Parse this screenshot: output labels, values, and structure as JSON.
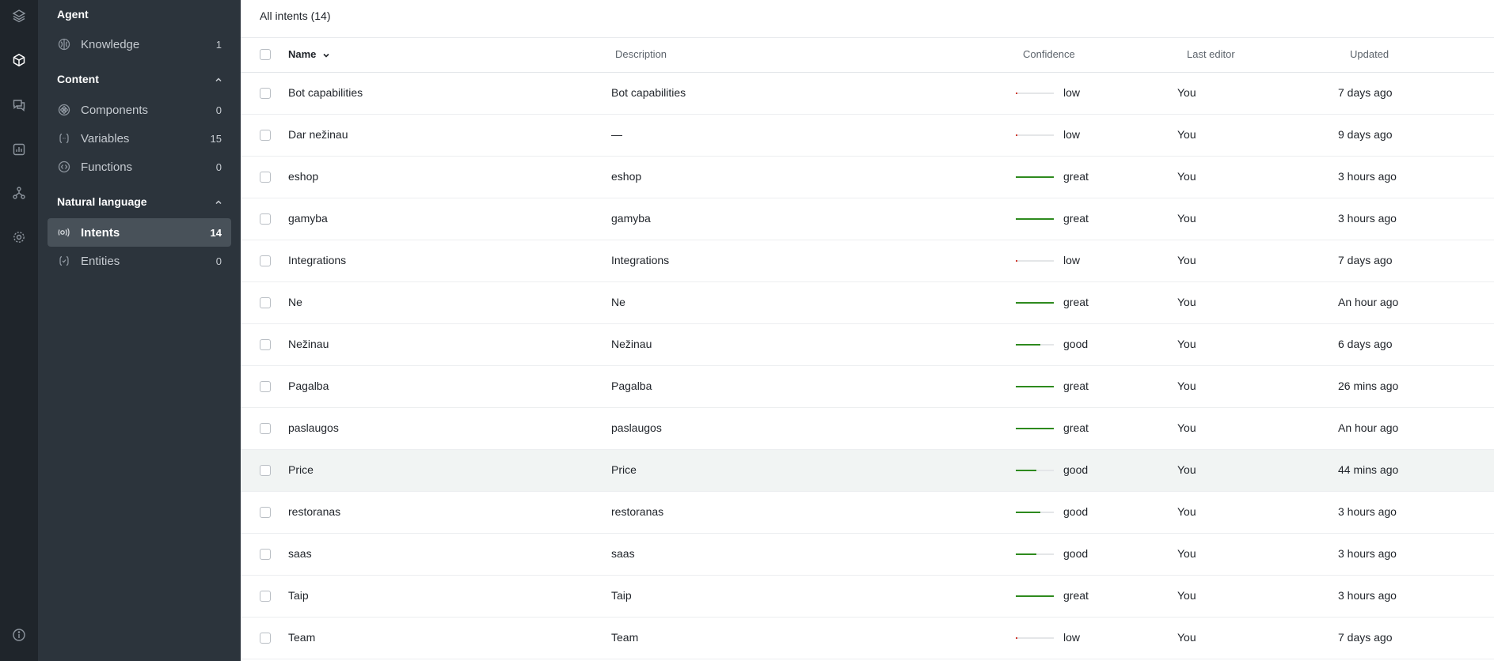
{
  "sidebar": {
    "sections": [
      {
        "title": "Agent",
        "collapsible": false,
        "items": [
          {
            "label": "Knowledge",
            "count": "1",
            "icon": "brain-icon"
          }
        ]
      },
      {
        "title": "Content",
        "collapsible": true,
        "items": [
          {
            "label": "Components",
            "count": "0",
            "icon": "components-icon"
          },
          {
            "label": "Variables",
            "count": "15",
            "icon": "variables-icon"
          },
          {
            "label": "Functions",
            "count": "0",
            "icon": "functions-icon"
          }
        ]
      },
      {
        "title": "Natural language",
        "collapsible": true,
        "items": [
          {
            "label": "Intents",
            "count": "14",
            "icon": "intents-icon",
            "active": true
          },
          {
            "label": "Entities",
            "count": "0",
            "icon": "entities-icon"
          }
        ]
      }
    ]
  },
  "main": {
    "title": "All intents (14)",
    "columns": {
      "name": "Name",
      "description": "Description",
      "confidence": "Confidence",
      "last_editor": "Last editor",
      "updated": "Updated"
    },
    "rows": [
      {
        "name": "Bot capabilities",
        "description": "Bot capabilities",
        "confidence": "low",
        "level": 0.04,
        "editor": "You",
        "updated": "7 days ago"
      },
      {
        "name": "Dar nežinau",
        "description": "—",
        "confidence": "low",
        "level": 0.04,
        "editor": "You",
        "updated": "9 days ago"
      },
      {
        "name": "eshop",
        "description": "eshop",
        "confidence": "great",
        "level": 1.0,
        "editor": "You",
        "updated": "3 hours ago"
      },
      {
        "name": "gamyba",
        "description": "gamyba",
        "confidence": "great",
        "level": 1.0,
        "editor": "You",
        "updated": "3 hours ago"
      },
      {
        "name": "Integrations",
        "description": "Integrations",
        "confidence": "low",
        "level": 0.04,
        "editor": "You",
        "updated": "7 days ago"
      },
      {
        "name": "Ne",
        "description": "Ne",
        "confidence": "great",
        "level": 1.0,
        "editor": "You",
        "updated": "An hour ago"
      },
      {
        "name": "Nežinau",
        "description": "Nežinau",
        "confidence": "good",
        "level": 0.65,
        "editor": "You",
        "updated": "6 days ago"
      },
      {
        "name": "Pagalba",
        "description": "Pagalba",
        "confidence": "great",
        "level": 1.0,
        "editor": "You",
        "updated": "26 mins ago"
      },
      {
        "name": "paslaugos",
        "description": "paslaugos",
        "confidence": "great",
        "level": 1.0,
        "editor": "You",
        "updated": "An hour ago"
      },
      {
        "name": "Price",
        "description": "Price",
        "confidence": "good",
        "level": 0.55,
        "editor": "You",
        "updated": "44 mins ago",
        "hover": true
      },
      {
        "name": "restoranas",
        "description": "restoranas",
        "confidence": "good",
        "level": 0.65,
        "editor": "You",
        "updated": "3 hours ago"
      },
      {
        "name": "saas",
        "description": "saas",
        "confidence": "good",
        "level": 0.55,
        "editor": "You",
        "updated": "3 hours ago"
      },
      {
        "name": "Taip",
        "description": "Taip",
        "confidence": "great",
        "level": 1.0,
        "editor": "You",
        "updated": "3 hours ago"
      },
      {
        "name": "Team",
        "description": "Team",
        "confidence": "low",
        "level": 0.04,
        "editor": "You",
        "updated": "7 days ago"
      }
    ]
  },
  "colors": {
    "low": "#d0392f",
    "good": "#2e8a1e",
    "great": "#2e8a1e"
  }
}
